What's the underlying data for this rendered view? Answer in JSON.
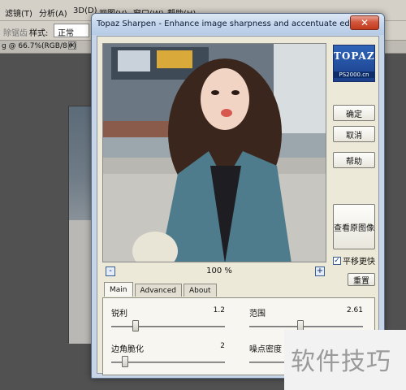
{
  "ps": {
    "menus": [
      "滤镜(T)",
      "分析(A)",
      "3D(D)",
      "视图(V)",
      "窗口(W)",
      "帮助(H)"
    ],
    "options": {
      "left_fragment": "除锯齿",
      "style_label": "样式:",
      "style_value": "正常"
    },
    "doc_tab": "g @ 66.7%(RGB/8#)"
  },
  "dialog": {
    "title": "Topaz Sharpen - Enhance image sharpness and accentuate edges",
    "close_icon": "close-icon",
    "zoom": {
      "label": "100 %",
      "minus": "-",
      "plus": "+"
    },
    "logo": {
      "main": "TOPAZ",
      "sub": "PS2000.cn"
    },
    "buttons": {
      "ok": "确定",
      "cancel": "取消",
      "help": "帮助",
      "compare": "查看原图像",
      "reset": "重置"
    },
    "pan_checkbox": {
      "label": "平移更快",
      "checked": true
    },
    "tabs": [
      "Main",
      "Advanced",
      "About"
    ],
    "active_tab": "Main",
    "params": [
      {
        "label": "锐利",
        "value": "1.2",
        "level": 0.2
      },
      {
        "label": "范围",
        "value": "2.61",
        "level": 0.45
      },
      {
        "label": "边角脆化",
        "value": "2",
        "level": 0.1
      },
      {
        "label": "噪点密度",
        "value": "",
        "level": 0.5
      }
    ]
  },
  "watermark": {
    "text": "软件技巧"
  },
  "colors": {
    "dialog_frame": "#c8d5e6",
    "close_button": "#c13a1d",
    "logo_blue": "#1b3f8a",
    "coat_teal": "#4f7c8c"
  }
}
